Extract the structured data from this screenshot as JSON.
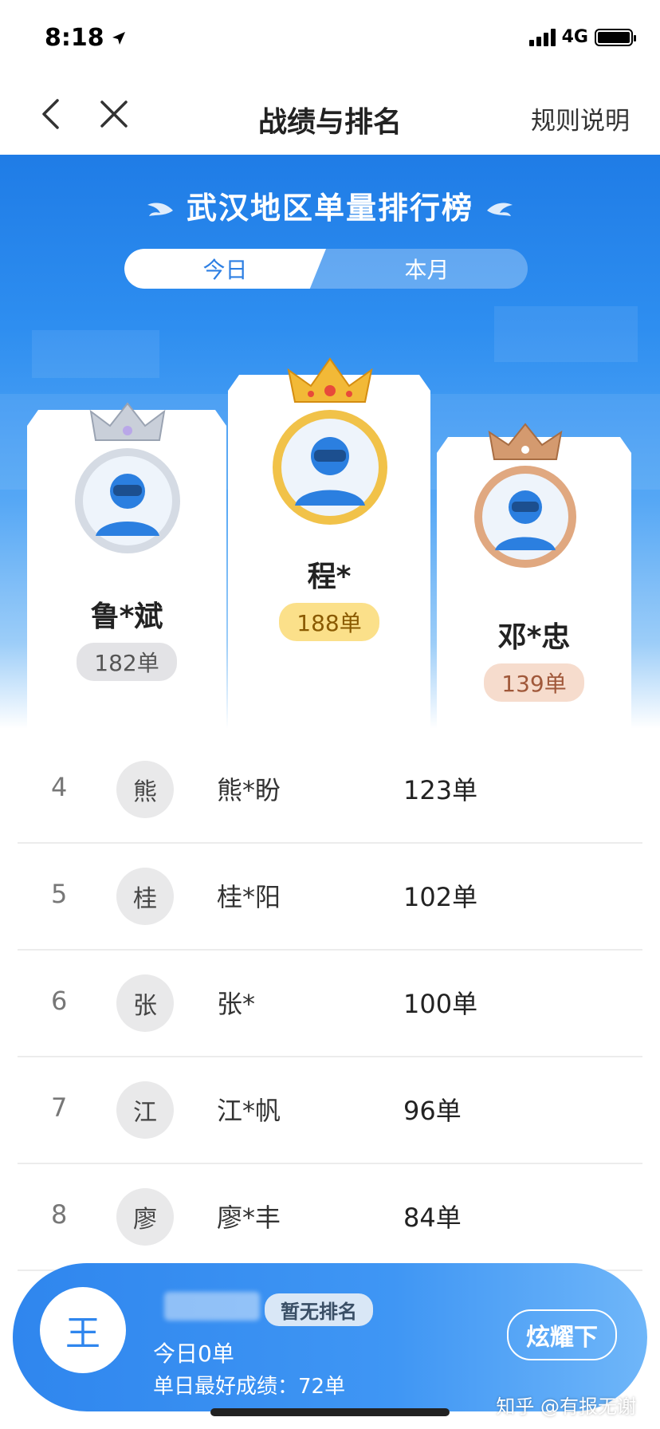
{
  "status_bar": {
    "time": "8:18",
    "network": "4G",
    "location_icon": "location-arrow-icon",
    "signal_icon": "signal-icon",
    "battery_icon": "battery-icon"
  },
  "nav": {
    "title": "战绩与排名",
    "rules_label": "规则说明",
    "back_icon": "back-chevron-icon",
    "close_icon": "close-icon"
  },
  "board": {
    "title": "武汉地区单量排行榜",
    "tabs": [
      {
        "label": "今日",
        "active": true
      },
      {
        "label": "本月",
        "active": false
      }
    ]
  },
  "podium": {
    "first": {
      "name": "程*",
      "count": "188单",
      "crown_color": "#f2b937",
      "ring_color": "#f1c249"
    },
    "second": {
      "name": "鲁*斌",
      "count": "182单",
      "crown_color": "#c9cfd9",
      "ring_color": "#d5dbe4"
    },
    "third": {
      "name": "邓*忠",
      "count": "139单",
      "crown_color": "#d49a6f",
      "ring_color": "#e0a880"
    }
  },
  "ranking": [
    {
      "rank": "4",
      "avatar_char": "熊",
      "name": "熊*盼",
      "count": "123单"
    },
    {
      "rank": "5",
      "avatar_char": "桂",
      "name": "桂*阳",
      "count": "102单"
    },
    {
      "rank": "6",
      "avatar_char": "张",
      "name": "张*",
      "count": "100单"
    },
    {
      "rank": "7",
      "avatar_char": "江",
      "name": "江*帆",
      "count": "96单"
    },
    {
      "rank": "8",
      "avatar_char": "廖",
      "name": "廖*丰",
      "count": "84单"
    }
  ],
  "my_card": {
    "avatar_char": "王",
    "rank_status": "暂无排名",
    "today": "今日0单",
    "best": "单日最好成绩：72单",
    "show_off_label": "炫耀下"
  },
  "watermark": "知乎 @有报无谢",
  "colors": {
    "primary_blue": "#2f86ee",
    "gold": "#fbe08a",
    "silver": "#e3e3e6",
    "bronze": "#f6dccd"
  }
}
